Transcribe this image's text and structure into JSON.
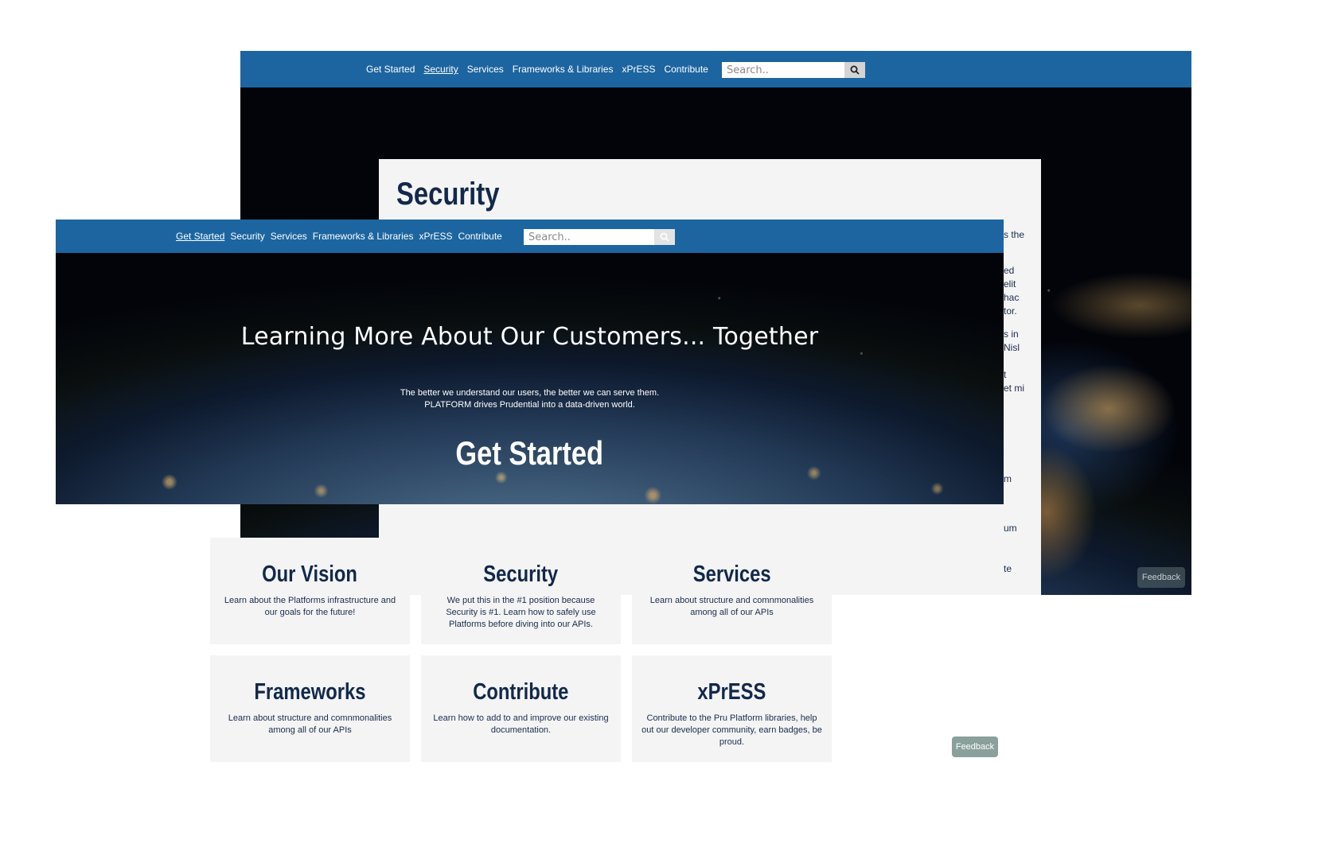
{
  "colors": {
    "nav_bg": "#1c65a0",
    "heading_navy": "#12284c",
    "card_bg": "#f4f4f4",
    "feedback_bg": "#8aa09a"
  },
  "back_window": {
    "nav": {
      "links": [
        "Get Started",
        "Security",
        "Services",
        "Frameworks & Libraries",
        "xPrESS",
        "Contribute"
      ],
      "active": "Security"
    },
    "search": {
      "placeholder": "Search..",
      "button_icon": "search-icon"
    },
    "panel": {
      "title": "Security",
      "fragments": [
        "s the",
        "ed",
        "elit",
        "hac",
        "tor.",
        "s in",
        "Nisl",
        "t",
        "et mi",
        "m",
        "um",
        "te"
      ]
    },
    "feedback": "Feedback"
  },
  "front_window": {
    "nav": {
      "links": [
        "Get Started",
        "Security",
        "Services",
        "Frameworks & Libraries",
        "xPrESS",
        "Contribute"
      ],
      "active": "Get Started"
    },
    "search": {
      "placeholder": "Search..",
      "button_icon": "search-icon"
    },
    "hero": {
      "title": "Learning More About Our Customers... Together",
      "subtitle_line1": "The better we understand our users, the better we can serve them.",
      "subtitle_line2": "PLATFORM drives Prudential into a data-driven world.",
      "cta": "Get Started"
    },
    "cards": [
      {
        "title": "Our Vision",
        "desc": "Learn about the Platforms infrastructure and our goals for the future!"
      },
      {
        "title": "Security",
        "desc": "We put this in the #1 position because Security is #1. Learn how to safely use Platforms before diving into our APIs."
      },
      {
        "title": "Services",
        "desc": "Learn about structure and comnmonalities among all of our APIs"
      },
      {
        "title": "Frameworks",
        "desc": "Learn about structure and comnmonalities among all of our APIs"
      },
      {
        "title": "Contribute",
        "desc": "Learn how to add to and improve our existing documentation."
      },
      {
        "title": "xPrESS",
        "desc": "Contribute to the Pru Platform libraries, help out our developer community, earn badges, be proud."
      }
    ],
    "feedback": "Feedback"
  }
}
